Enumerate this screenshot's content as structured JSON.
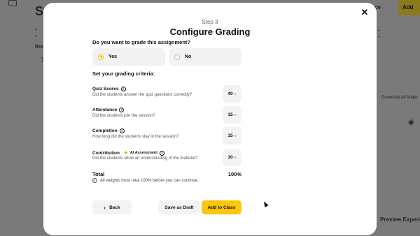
{
  "background": {
    "title": "S",
    "insights_label": "Insi",
    "row_number": "1",
    "header_fragment": "ce",
    "add_fragment": "Add",
    "download_label": "Download All Mater",
    "preview_label": "Preview Experien"
  },
  "modal": {
    "step": "Step 3",
    "title": "Configure Grading",
    "question": "Do you want to grade this assignment?",
    "options": [
      {
        "label": "Yes",
        "selected": true
      },
      {
        "label": "No",
        "selected": false
      }
    ],
    "criteria_heading": "Set your grading criteria:",
    "criteria": [
      {
        "name": "Quiz Scores",
        "description": "Did the students answer the quiz questions correctly?",
        "value": "40",
        "unit": "%"
      },
      {
        "name": "Attendance",
        "description": "Did the students join the session?",
        "value": "15",
        "unit": "%"
      },
      {
        "name": "Completion",
        "description": "How long did the students stay in the session?",
        "value": "15",
        "unit": "%"
      },
      {
        "name": "Contribution",
        "tag": "AI Assessment",
        "description": "Did the students show an understanding of the material?",
        "value": "30",
        "unit": "%"
      }
    ],
    "total_label": "Total",
    "total_value": "100%",
    "note": "All weights must total 100% before you can continue.",
    "buttons": {
      "back": "Back",
      "draft": "Save as Draft",
      "add": "Add to Class"
    }
  },
  "colors": {
    "accent": "#fbc60b",
    "overlay": "#7a7a7a"
  }
}
